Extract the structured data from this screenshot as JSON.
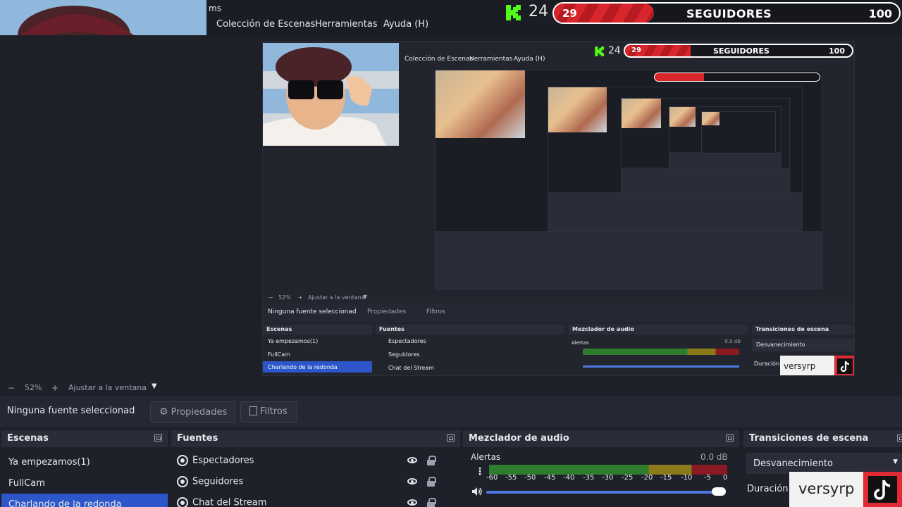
{
  "menubar": {
    "title_fragment": "ms",
    "items": [
      "Colección de Escenas",
      "Herramientas",
      "Ayuda (H)"
    ]
  },
  "widget": {
    "count": "24",
    "goal_current": "29",
    "goal_label": "SEGUIDORES",
    "goal_target": "100",
    "goal_fraction": 0.29
  },
  "preview": {
    "nested": {
      "menu_items": [
        "Colección de Escenas",
        "Herramientas",
        "Ayuda (H)"
      ],
      "count": "24",
      "goal_current": "29",
      "goal_label": "SEGUIDORES",
      "goal_target": "100",
      "zoom_pct": "52%",
      "fit_label": "Ajustar a la ventana",
      "no_source": "Ninguna fuente seleccionad",
      "properties": "Propiedades",
      "filters": "Filtros",
      "scenes_title": "Escenas",
      "sources_title": "Fuentes",
      "mixer_title": "Mezclador de audio",
      "transitions_title": "Transiciones de escena",
      "scenes": [
        "Ya empezamos(1)",
        "FullCam",
        "Charlando de la redonda"
      ],
      "sources": [
        "Espectadores",
        "Seguidores",
        "Chat del Stream"
      ],
      "mixer_track": "Alertas",
      "mixer_db": "0.0 dB",
      "transition": "Desvanecimiento",
      "duration_label": "Duración",
      "tiktok_user": "versyrp"
    }
  },
  "zoombar": {
    "minus": "−",
    "zoom_pct": "52%",
    "plus": "+",
    "fit_label": "Ajustar a la ventana"
  },
  "sourcebar": {
    "no_source": "Ninguna fuente seleccionad",
    "properties": "Propiedades",
    "filters": "Filtros"
  },
  "docks": {
    "scenes": {
      "title": "Escenas",
      "items": [
        "Ya empezamos(1)",
        "FullCam",
        "Charlando de la redonda"
      ],
      "selected_index": 2
    },
    "sources": {
      "title": "Fuentes",
      "items": [
        "Espectadores",
        "Seguidores",
        "Chat del Stream"
      ]
    },
    "mixer": {
      "title": "Mezclador de audio",
      "track": "Alertas",
      "db": "0.0 dB",
      "ticks": [
        "-60",
        "-55",
        "-50",
        "-45",
        "-40",
        "-35",
        "-30",
        "-25",
        "-20",
        "-15",
        "-10",
        "-5",
        "0"
      ]
    },
    "transitions": {
      "title": "Transiciones de escena",
      "selected": "Desvanecimiento",
      "duration_label": "Duración"
    }
  },
  "tiktok": {
    "username": "versyrp"
  },
  "colors": {
    "accent": "#2c56c9",
    "goal_red": "#d9262c",
    "kick_green": "#53fc18",
    "meter_green": "#2e7d2e",
    "meter_yellow": "#8a7a1a",
    "meter_red": "#8a1a22"
  }
}
